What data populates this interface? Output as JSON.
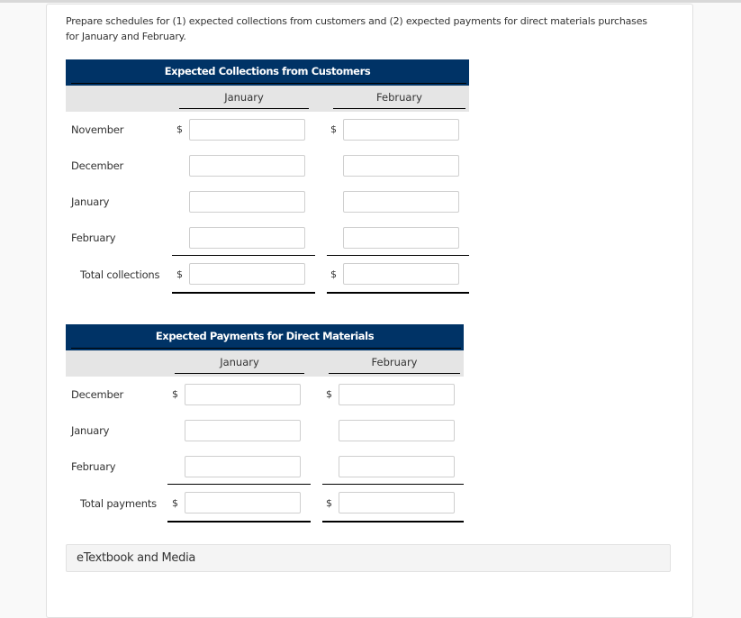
{
  "prompt": "Prepare schedules for (1) expected collections from customers and (2) expected payments for direct materials purchases for January and February.",
  "collections": {
    "title": "Expected Collections from Customers",
    "columns": [
      "January",
      "February"
    ],
    "currency_symbol": "$",
    "rows": [
      {
        "label": "November",
        "values": [
          "",
          ""
        ]
      },
      {
        "label": "December",
        "values": [
          "",
          ""
        ]
      },
      {
        "label": "January",
        "values": [
          "",
          ""
        ]
      },
      {
        "label": "February",
        "values": [
          "",
          ""
        ]
      }
    ],
    "total": {
      "label": "Total collections",
      "values": [
        "",
        ""
      ]
    }
  },
  "payments": {
    "title": "Expected Payments for Direct Materials",
    "columns": [
      "January",
      "February"
    ],
    "currency_symbol": "$",
    "rows": [
      {
        "label": "December",
        "values": [
          "",
          ""
        ]
      },
      {
        "label": "January",
        "values": [
          "",
          ""
        ]
      },
      {
        "label": "February",
        "values": [
          "",
          ""
        ]
      }
    ],
    "total": {
      "label": "Total payments",
      "values": [
        "",
        ""
      ]
    }
  },
  "etextbook": {
    "label": "eTextbook and Media"
  },
  "colors": {
    "header_bg": "#003366",
    "subheader_bg": "#e5e5e5"
  }
}
